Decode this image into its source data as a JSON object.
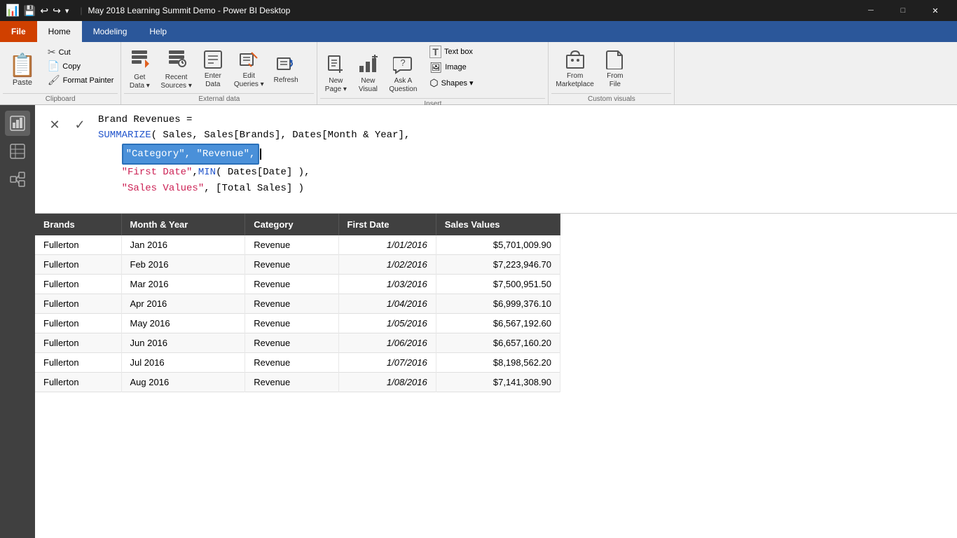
{
  "titlebar": {
    "title": "May 2018 Learning Summit Demo - Power BI Desktop",
    "icons": [
      "chart-icon",
      "save-icon",
      "undo-icon",
      "redo-icon",
      "customize-icon"
    ]
  },
  "tabs": [
    {
      "id": "file",
      "label": "File",
      "type": "file"
    },
    {
      "id": "home",
      "label": "Home",
      "type": "active"
    },
    {
      "id": "modeling",
      "label": "Modeling",
      "type": "normal"
    },
    {
      "id": "help",
      "label": "Help",
      "type": "normal"
    }
  ],
  "ribbon": {
    "groups": [
      {
        "id": "clipboard",
        "label": "Clipboard",
        "items": [
          {
            "id": "paste",
            "label": "Paste",
            "icon": "📋",
            "size": "large"
          },
          {
            "id": "cut",
            "label": "Cut",
            "icon": "✂",
            "size": "small"
          },
          {
            "id": "copy",
            "label": "Copy",
            "icon": "📄",
            "size": "small"
          },
          {
            "id": "format-painter",
            "label": "Format Painter",
            "icon": "🖌",
            "size": "small"
          }
        ]
      },
      {
        "id": "external-data",
        "label": "External data",
        "items": [
          {
            "id": "get-data",
            "label": "Get\nData ▾",
            "icon": "🗄",
            "size": "large"
          },
          {
            "id": "recent-sources",
            "label": "Recent\nSources ▾",
            "icon": "🕐",
            "size": "large"
          },
          {
            "id": "enter-data",
            "label": "Enter\nData",
            "icon": "📊",
            "size": "large"
          },
          {
            "id": "edit-queries",
            "label": "Edit\nQueries ▾",
            "icon": "✏",
            "size": "large"
          },
          {
            "id": "refresh",
            "label": "Refresh",
            "icon": "🔄",
            "size": "large"
          }
        ]
      },
      {
        "id": "insert",
        "label": "Insert",
        "items": [
          {
            "id": "new-page",
            "label": "New\nPage ▾",
            "icon": "📄",
            "size": "large"
          },
          {
            "id": "new-visual",
            "label": "New\nVisual",
            "icon": "📊",
            "size": "large"
          },
          {
            "id": "ask-question",
            "label": "Ask A\nQuestion",
            "icon": "💬",
            "size": "large"
          },
          {
            "id": "text-box",
            "label": "Text box",
            "icon": "T",
            "size": "small-inline"
          },
          {
            "id": "image",
            "label": "Image",
            "icon": "🖼",
            "size": "small-inline"
          },
          {
            "id": "shapes",
            "label": "Shapes ▾",
            "icon": "⬡",
            "size": "small-inline"
          }
        ]
      },
      {
        "id": "custom-visuals",
        "label": "Custom visuals",
        "items": [
          {
            "id": "from-marketplace",
            "label": "From\nMarketplace",
            "icon": "🏪",
            "size": "large"
          },
          {
            "id": "from-file",
            "label": "From\nFile",
            "icon": "📂",
            "size": "large"
          }
        ]
      }
    ]
  },
  "sidebar": {
    "items": [
      {
        "id": "report-view",
        "icon": "📊",
        "label": "Report view"
      },
      {
        "id": "data-view",
        "icon": "⊞",
        "label": "Data view"
      },
      {
        "id": "model-view",
        "icon": "⬡",
        "label": "Model view"
      }
    ]
  },
  "formula": {
    "cancel_label": "✕",
    "confirm_label": "✓",
    "lines": [
      {
        "id": "line1",
        "text": "Brand Revenues ="
      },
      {
        "id": "line2",
        "text": "SUMMARIZE( Sales, Sales[Brands], Dates[Month & Year],"
      },
      {
        "id": "line3",
        "text_before": "    ",
        "highlighted": "\"Category\", \"Revenue\",",
        "text_after": ""
      },
      {
        "id": "line4",
        "text": "    \"First Date\", MIN( Dates[Date] ),"
      },
      {
        "id": "line5",
        "text": "    \"Sales Values\", [Total Sales] )"
      }
    ]
  },
  "table": {
    "headers": [
      "Brands",
      "Month & Year",
      "Category",
      "First Date",
      "Sales Values"
    ],
    "rows": [
      {
        "brand": "Fullerton",
        "month": "Jan 2016",
        "category": "Revenue",
        "date": "1/01/2016",
        "sales": "$5,701,009.90"
      },
      {
        "brand": "Fullerton",
        "month": "Feb 2016",
        "category": "Revenue",
        "date": "1/02/2016",
        "sales": "$7,223,946.70"
      },
      {
        "brand": "Fullerton",
        "month": "Mar 2016",
        "category": "Revenue",
        "date": "1/03/2016",
        "sales": "$7,500,951.50"
      },
      {
        "brand": "Fullerton",
        "month": "Apr 2016",
        "category": "Revenue",
        "date": "1/04/2016",
        "sales": "$6,999,376.10"
      },
      {
        "brand": "Fullerton",
        "month": "May 2016",
        "category": "Revenue",
        "date": "1/05/2016",
        "sales": "$6,567,192.60"
      },
      {
        "brand": "Fullerton",
        "month": "Jun 2016",
        "category": "Revenue",
        "date": "1/06/2016",
        "sales": "$6,657,160.20"
      },
      {
        "brand": "Fullerton",
        "month": "Jul 2016",
        "category": "Revenue",
        "date": "1/07/2016",
        "sales": "$8,198,562.20"
      },
      {
        "brand": "Fullerton",
        "month": "Aug 2016",
        "category": "Revenue",
        "date": "1/08/2016",
        "sales": "$7,141,308.90"
      }
    ]
  }
}
